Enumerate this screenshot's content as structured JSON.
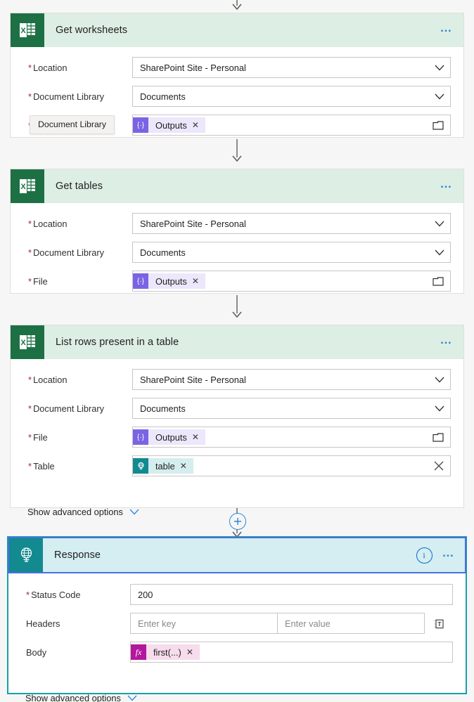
{
  "canvas": {
    "background": "#f6f6f6",
    "accent": "#2b88d8"
  },
  "tooltip": {
    "text": "Document Library"
  },
  "labels": {
    "location": "Location",
    "document_library": "Document Library",
    "file": "File",
    "table": "Table",
    "status_code": "Status Code",
    "headers": "Headers",
    "body": "Body",
    "show_advanced": "Show advanced options",
    "required_marker": "*"
  },
  "cards": [
    {
      "id": "get-worksheets",
      "title": "Get worksheets",
      "icon": "excel-icon",
      "icon_color": "#1d7044",
      "header_color": "#ddeee4",
      "selected": false,
      "menu_label": "…",
      "fields": [
        {
          "name": "location",
          "label": "Location",
          "required": true,
          "type": "dropdown",
          "value": "SharePoint Site - Personal"
        },
        {
          "name": "document-library",
          "label": "Document Library",
          "required": true,
          "type": "dropdown",
          "value": "Documents"
        },
        {
          "name": "file",
          "label": "File",
          "required": true,
          "type": "token-picker",
          "token": {
            "text": "Outputs",
            "badge": "{·}",
            "style": "purple"
          },
          "trailing_icon": "folder-icon"
        }
      ]
    },
    {
      "id": "get-tables",
      "title": "Get tables",
      "icon": "excel-icon",
      "icon_color": "#1d7044",
      "header_color": "#ddeee4",
      "selected": false,
      "menu_label": "…",
      "fields": [
        {
          "name": "location",
          "label": "Location",
          "required": true,
          "type": "dropdown",
          "value": "SharePoint Site - Personal"
        },
        {
          "name": "document-library",
          "label": "Document Library",
          "required": true,
          "type": "dropdown",
          "value": "Documents"
        },
        {
          "name": "file",
          "label": "File",
          "required": true,
          "type": "token-picker",
          "token": {
            "text": "Outputs",
            "badge": "{·}",
            "style": "purple"
          },
          "trailing_icon": "folder-icon"
        }
      ]
    },
    {
      "id": "list-rows-present-in-a-table",
      "title": "List rows present in a table",
      "icon": "excel-icon",
      "icon_color": "#1d7044",
      "header_color": "#ddeee4",
      "selected": false,
      "menu_label": "…",
      "show_advanced": "Show advanced options",
      "fields": [
        {
          "name": "location",
          "label": "Location",
          "required": true,
          "type": "dropdown",
          "value": "SharePoint Site - Personal"
        },
        {
          "name": "document-library",
          "label": "Document Library",
          "required": true,
          "type": "dropdown",
          "value": "Documents"
        },
        {
          "name": "file",
          "label": "File",
          "required": true,
          "type": "token-picker",
          "token": {
            "text": "Outputs",
            "badge": "{·}",
            "style": "purple"
          },
          "trailing_icon": "folder-icon"
        },
        {
          "name": "table",
          "label": "Table",
          "required": true,
          "type": "token-picker",
          "token": {
            "text": "table",
            "badge": "⊕",
            "style": "teal"
          },
          "trailing_icon": "close-icon"
        }
      ]
    },
    {
      "id": "response",
      "title": "Response",
      "icon": "http-response-icon",
      "icon_color": "#128a8f",
      "header_color": "#d4eef1",
      "selected": true,
      "selection_color": "#19a0a8",
      "header_outline_color": "#4a6ee0",
      "info_label": "i",
      "menu_label": "…",
      "show_advanced": "Show advanced options",
      "fields": [
        {
          "name": "status-code",
          "label": "Status Code",
          "required": true,
          "type": "text",
          "value": "200"
        },
        {
          "name": "headers",
          "label": "Headers",
          "required": false,
          "type": "key-value",
          "key_placeholder": "Enter key",
          "value_placeholder": "Enter value",
          "trailing_icon": "insert-item-icon"
        },
        {
          "name": "body",
          "label": "Body",
          "required": false,
          "type": "token",
          "token": {
            "text": "first(...)",
            "badge": "fx",
            "style": "magenta"
          }
        }
      ]
    }
  ],
  "connectors": [
    {
      "name": "arrow-top",
      "type": "arrow"
    },
    {
      "name": "arrow-worksheets-to-tables",
      "type": "arrow"
    },
    {
      "name": "arrow-tables-to-listrows",
      "type": "arrow"
    },
    {
      "name": "arrow-listrows-to-response",
      "type": "arrow-with-add",
      "add_label": "+"
    }
  ]
}
